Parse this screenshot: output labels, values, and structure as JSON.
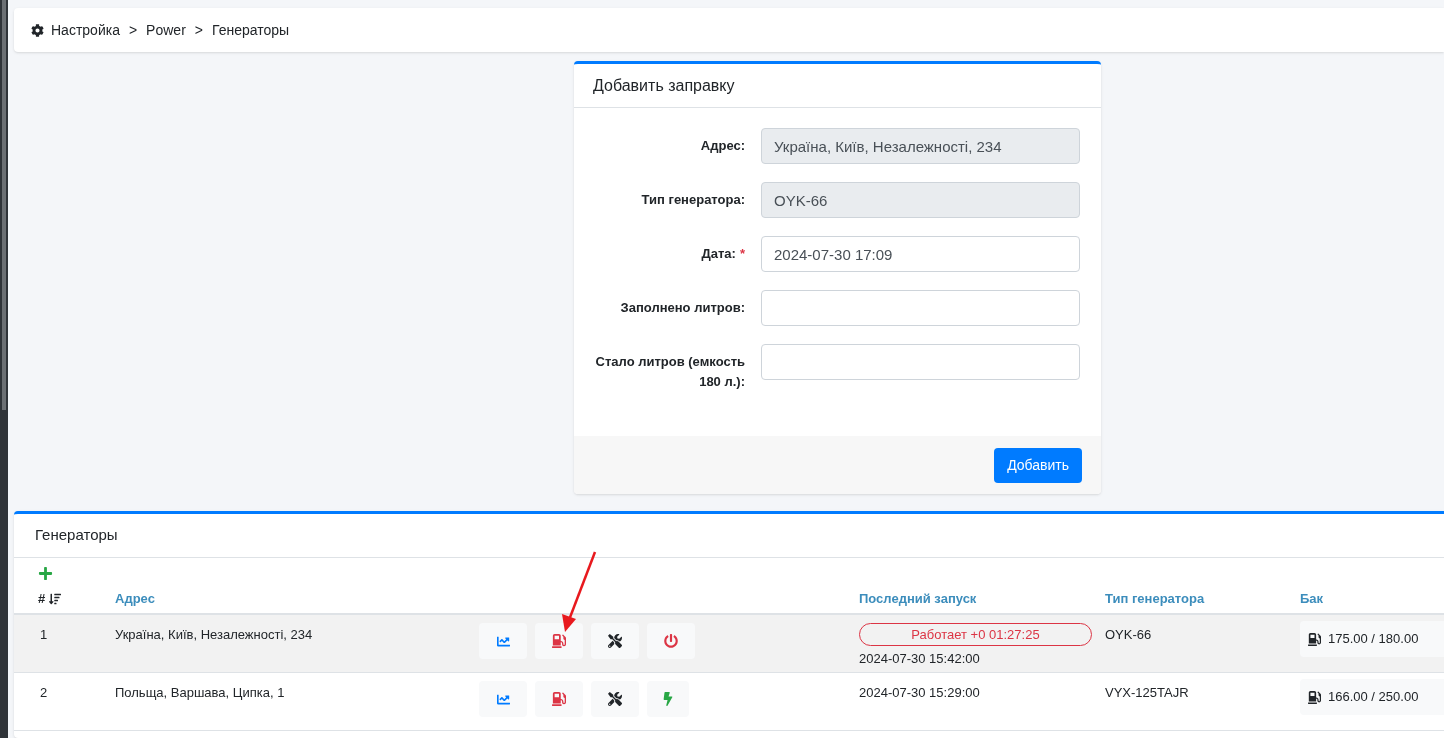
{
  "breadcrumb": [
    "Настройка",
    "Power",
    "Генераторы"
  ],
  "breadcrumb_separator": ">",
  "form": {
    "title": "Добавить заправку",
    "fields": [
      {
        "label": "Адрес:",
        "value": "Україна, Київ, Незалежності, 234",
        "required": false,
        "disabled": true
      },
      {
        "label": "Тип генератора:",
        "value": "OYK-66",
        "required": false,
        "disabled": true
      },
      {
        "label": "Дата:",
        "value": "2024-07-30 17:09",
        "required": true,
        "disabled": false
      },
      {
        "label": "Заполнено литров:",
        "required": false,
        "disabled": false
      },
      {
        "label": "Стало литров (емкость 180 л.):",
        "required": false,
        "disabled": false
      }
    ],
    "required_mark": "*",
    "submit": "Добавить"
  },
  "generators": {
    "title": "Генераторы",
    "columns": [
      "#",
      "Адрес",
      "Последний запуск",
      "Тип генератора",
      "Бак"
    ],
    "rows": [
      {
        "number": "1",
        "address": "Україна, Київ, Незалежності, 234",
        "selected": true,
        "running": true,
        "status": "Работает +0 01:27:25",
        "last_start": "2024-07-30 15:42:00",
        "type": "OYK-66",
        "tank": "175.00 / 180.00"
      },
      {
        "number": "2",
        "address": "Польща, Варшава, Ципка, 1",
        "selected": false,
        "running": false,
        "last_start": "2024-07-30 15:29:00",
        "type": "VYX-125TAJR",
        "tank": "166.00 / 250.00"
      }
    ]
  }
}
